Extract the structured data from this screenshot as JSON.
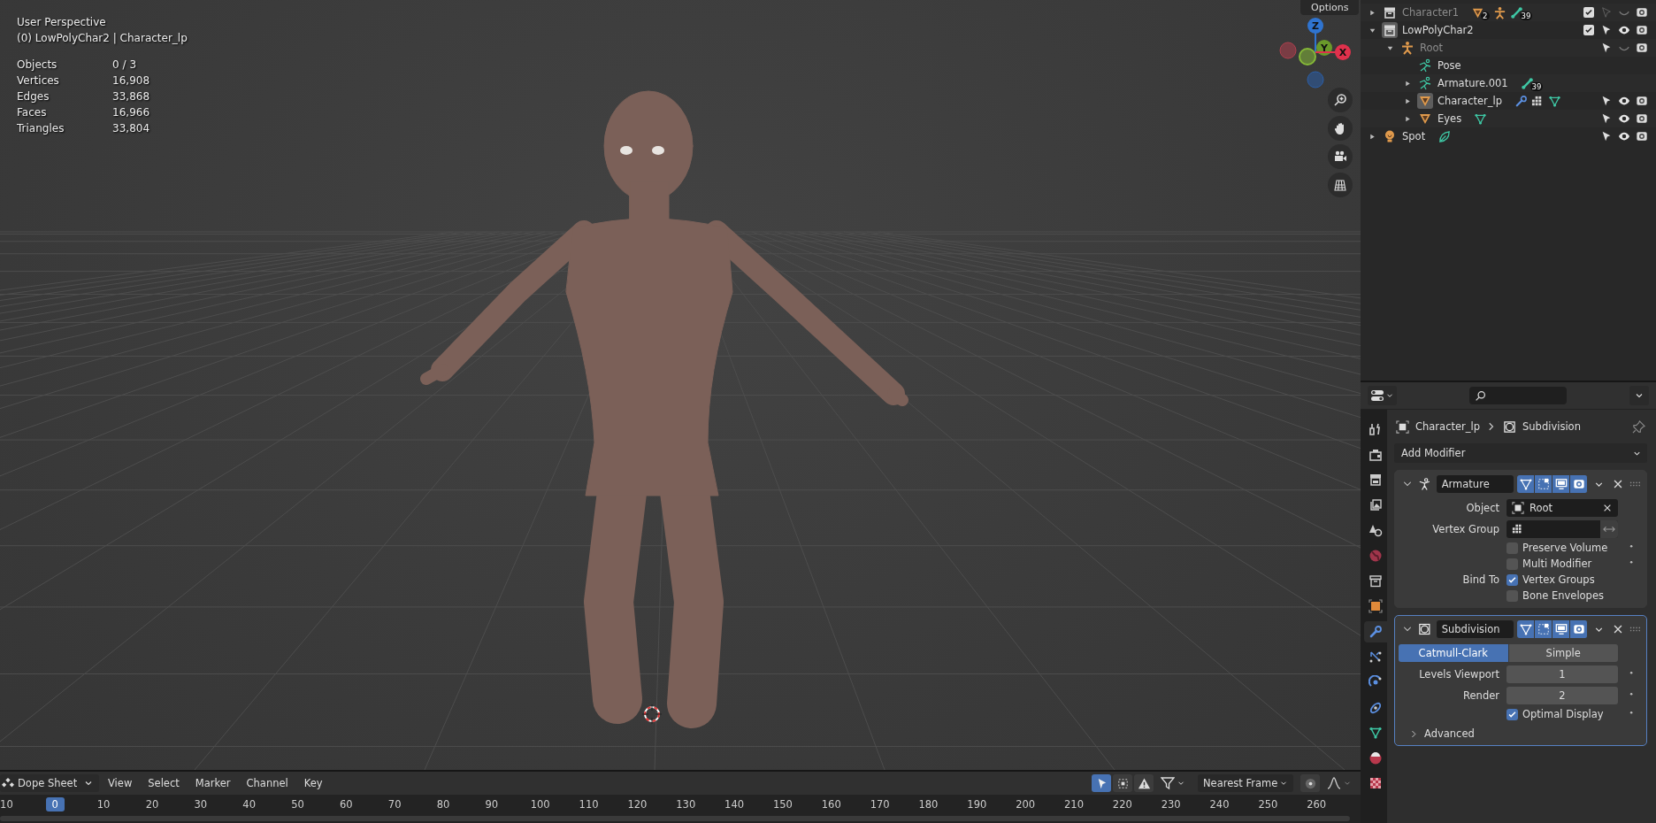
{
  "viewport": {
    "options_button": "Options",
    "header_lines": [
      "User Perspective",
      "(0) LowPolyChar2 | Character_lp"
    ],
    "stats": [
      {
        "label": "Objects",
        "value": "0 / 3"
      },
      {
        "label": "Vertices",
        "value": "16,908"
      },
      {
        "label": "Edges",
        "value": "33,868"
      },
      {
        "label": "Faces",
        "value": "16,966"
      },
      {
        "label": "Triangles",
        "value": "33,804"
      }
    ],
    "gizmo_axes": [
      {
        "label": "Z",
        "kind": "z"
      },
      {
        "label": "Y",
        "kind": "y"
      },
      {
        "label": "X",
        "kind": "x"
      }
    ],
    "nav_buttons": [
      {
        "kind": "zoom"
      },
      {
        "kind": "pan"
      },
      {
        "kind": "camera"
      },
      {
        "kind": "ortho"
      }
    ]
  },
  "outliner": {
    "items": [
      {
        "name": "Character1",
        "kind": "collection",
        "expanded": false,
        "dimmed": true,
        "active": false,
        "included": true,
        "selectable": false,
        "visible": false,
        "extras": [
          {
            "kind": "mesh",
            "count": "2"
          },
          {
            "kind": "armature"
          },
          {
            "kind": "bone",
            "count": "39"
          }
        ]
      },
      {
        "name": "LowPolyChar2",
        "kind": "collection",
        "expanded": true,
        "dimmed": false,
        "active": true,
        "included": true,
        "selectable": true,
        "visible": true,
        "children": [
          {
            "name": "Root",
            "kind": "armature",
            "expanded": true,
            "dimmed": true,
            "active": false,
            "selectable": true,
            "visible": false,
            "children": [
              {
                "name": "Pose",
                "kind": "pose",
                "dimmed": false,
                "active": false
              },
              {
                "name": "Armature.001",
                "kind": "armature-data",
                "expanded": false,
                "dimmed": false,
                "active": false,
                "extras": [
                  {
                    "kind": "bone",
                    "count": "39"
                  }
                ]
              },
              {
                "name": "Character_lp",
                "kind": "mesh",
                "expanded": false,
                "dimmed": false,
                "active": true,
                "selectable": true,
                "visible": true,
                "extras": [
                  {
                    "kind": "modifier"
                  },
                  {
                    "kind": "vertex-groups"
                  },
                  {
                    "kind": "mesh-data"
                  }
                ]
              },
              {
                "name": "Eyes",
                "kind": "mesh",
                "expanded": false,
                "dimmed": false,
                "active": false,
                "selectable": true,
                "visible": true,
                "extras": [
                  {
                    "kind": "mesh-data"
                  }
                ]
              }
            ]
          }
        ]
      },
      {
        "name": "Spot",
        "kind": "light",
        "expanded": false,
        "dimmed": false,
        "active": false,
        "selectable": true,
        "visible": true,
        "extras": [
          {
            "kind": "light-data"
          }
        ]
      }
    ]
  },
  "properties": {
    "tabs": [
      {
        "kind": "tool",
        "selected": false
      },
      {
        "kind": "render",
        "selected": false
      },
      {
        "kind": "output",
        "selected": false
      },
      {
        "kind": "view-layer",
        "selected": false
      },
      {
        "kind": "scene",
        "selected": false
      },
      {
        "kind": "world",
        "selected": false
      },
      {
        "kind": "collection",
        "selected": false
      },
      {
        "kind": "object",
        "selected": false
      },
      {
        "kind": "modifiers",
        "selected": true
      },
      {
        "kind": "particles",
        "selected": false
      },
      {
        "kind": "physics",
        "selected": false
      },
      {
        "kind": "constraints",
        "selected": false
      },
      {
        "kind": "data",
        "selected": false
      },
      {
        "kind": "material",
        "selected": false
      },
      {
        "kind": "texture",
        "selected": false
      }
    ],
    "breadcrumb": {
      "object": "Character_lp",
      "modifier": "Subdivision"
    },
    "add_modifier": "Add Modifier",
    "modifiers": [
      {
        "name": "Armature",
        "kind": "armature",
        "active": false,
        "expanded": true,
        "toggles": [
          {
            "kind": "on-cage",
            "on": true
          },
          {
            "kind": "edit-mode",
            "on": true
          },
          {
            "kind": "viewport",
            "on": true
          },
          {
            "kind": "render",
            "on": true
          }
        ],
        "rows": [
          {
            "kind": "object-field",
            "label": "Object",
            "value": "Root"
          },
          {
            "kind": "group-field",
            "label": "Vertex Group"
          },
          {
            "kind": "checkbox",
            "text": "Preserve Volume",
            "checked": false,
            "animatable": true
          },
          {
            "kind": "checkbox",
            "text": "Multi Modifier",
            "checked": false,
            "animatable": true
          },
          {
            "kind": "checkbox",
            "label": "Bind To",
            "text": "Vertex Groups",
            "checked": true
          },
          {
            "kind": "checkbox",
            "text": "Bone Envelopes",
            "checked": false
          }
        ]
      },
      {
        "name": "Subdivision",
        "kind": "subdivision",
        "active": true,
        "expanded": true,
        "toggles": [
          {
            "kind": "on-cage",
            "on": true
          },
          {
            "kind": "edit-mode",
            "on": true
          },
          {
            "kind": "viewport",
            "on": true
          },
          {
            "kind": "render",
            "on": true
          }
        ],
        "rows": [
          {
            "kind": "segmented",
            "options": [
              {
                "label": "Catmull-Clark",
                "selected": true
              },
              {
                "label": "Simple",
                "selected": false
              }
            ]
          },
          {
            "kind": "number",
            "label": "Levels Viewport",
            "value": "1",
            "animatable": true
          },
          {
            "kind": "number",
            "label": "Render",
            "value": "2",
            "animatable": true
          },
          {
            "kind": "checkbox",
            "text": "Optimal Display",
            "checked": true,
            "animatable": true
          },
          {
            "kind": "subpanel",
            "text": "Advanced",
            "expanded": false
          }
        ]
      }
    ]
  },
  "dope_sheet": {
    "editor": "Dope Sheet",
    "menus": [
      "View",
      "Select",
      "Marker",
      "Channel",
      "Key"
    ],
    "toggles": [
      {
        "kind": "only-selected",
        "on": true
      },
      {
        "kind": "hidden",
        "on": false
      },
      {
        "kind": "errors",
        "on": false
      }
    ],
    "snap": "Nearest Frame",
    "frames": [
      {
        "label": "10",
        "current": false
      },
      {
        "label": "0",
        "current": true
      },
      {
        "label": "10",
        "current": false
      },
      {
        "label": "20",
        "current": false
      },
      {
        "label": "30",
        "current": false
      },
      {
        "label": "40",
        "current": false
      },
      {
        "label": "50",
        "current": false
      },
      {
        "label": "60",
        "current": false
      },
      {
        "label": "70",
        "current": false
      },
      {
        "label": "80",
        "current": false
      },
      {
        "label": "90",
        "current": false
      },
      {
        "label": "100",
        "current": false
      },
      {
        "label": "110",
        "current": false
      },
      {
        "label": "120",
        "current": false
      },
      {
        "label": "130",
        "current": false
      },
      {
        "label": "140",
        "current": false
      },
      {
        "label": "150",
        "current": false
      },
      {
        "label": "160",
        "current": false
      },
      {
        "label": "170",
        "current": false
      },
      {
        "label": "180",
        "current": false
      },
      {
        "label": "190",
        "current": false
      },
      {
        "label": "200",
        "current": false
      },
      {
        "label": "210",
        "current": false
      },
      {
        "label": "220",
        "current": false
      },
      {
        "label": "230",
        "current": false
      },
      {
        "label": "240",
        "current": false
      },
      {
        "label": "250",
        "current": false
      },
      {
        "label": "260",
        "current": false
      }
    ]
  }
}
